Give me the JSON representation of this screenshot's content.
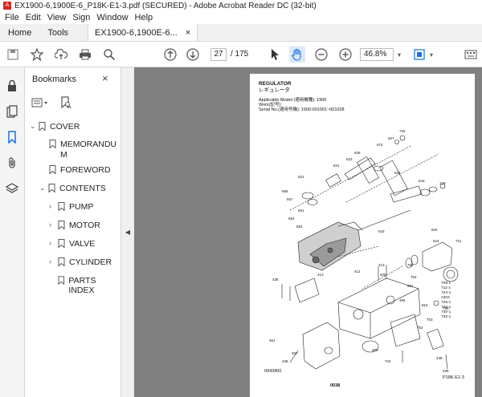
{
  "window": {
    "title": "EX1900-6,1900E-6_P18K-E1-3.pdf (SECURED) - Adobe Acrobat Reader DC (32-bit)"
  },
  "menu": [
    "File",
    "Edit",
    "View",
    "Sign",
    "Window",
    "Help"
  ],
  "tabs": {
    "home": "Home",
    "tools": "Tools",
    "doc": "EX1900-6,1900E-6...",
    "doc_close": "×"
  },
  "toolbar": {
    "page_current": "27",
    "page_total": "/ 175",
    "zoom": "46.8%"
  },
  "bookmarks": {
    "title": "Bookmarks",
    "close": "×",
    "items": [
      {
        "label": "COVER",
        "indent": 0,
        "toggle": "⌄"
      },
      {
        "label": "MEMORANDU",
        "indent": 1,
        "toggle": ""
      },
      {
        "label": "M",
        "indent": 1,
        "toggle": ""
      },
      {
        "label": "FOREWORD",
        "indent": 1,
        "toggle": ""
      },
      {
        "label": "CONTENTS",
        "indent": 1,
        "toggle": "⌄"
      },
      {
        "label": "PUMP",
        "indent": 2,
        "toggle": "›"
      },
      {
        "label": "MOTOR",
        "indent": 2,
        "toggle": "›"
      },
      {
        "label": "VALVE",
        "indent": 2,
        "toggle": "›"
      },
      {
        "label": "CYLINDER",
        "indent": 2,
        "toggle": "›"
      },
      {
        "label": "PARTS INDEX",
        "indent": 2,
        "toggle": ""
      }
    ]
  },
  "pdf": {
    "title": "REGULATOR",
    "title_jp": "レギュレータ",
    "applicable": "Applicable Model (適用機種): 1900",
    "work": "Work(記号):",
    "serial": "Serial No.(適用号機): 1900:001001~001028",
    "page_ref": "P18K-E1-3",
    "page_num": "0038",
    "fig_code": "0942800",
    "legend": [
      "708-1  733-1",
      "711-1  734-1",
      "724-1  754-1",
      "1303  755-1",
      "725-1  756-1",
      "726-1  762-1",
      "730-1  763-1",
      "732-1"
    ]
  },
  "colors": {
    "accent": "#1473e6",
    "viewer_bg": "#808080",
    "logo_red": "#d7261e"
  }
}
